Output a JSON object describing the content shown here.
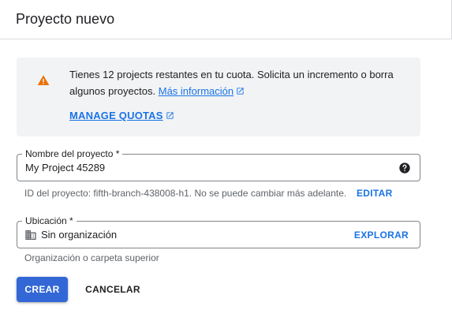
{
  "header": {
    "title": "Proyecto nuevo"
  },
  "notice": {
    "icon": "warning-icon",
    "text": "Tienes 12 projects restantes en tu cuota. Solicita un incremento o borra algunos proyectos.",
    "more_info_link": "Más información",
    "manage_quotas_link": "MANAGE QUOTAS"
  },
  "project_name_field": {
    "label": "Nombre del proyecto *",
    "value": "My Project 45289",
    "help_icon": "help-icon"
  },
  "project_id": {
    "text": "ID del proyecto: fifth-branch-438008-h1. No se puede cambiar más adelante.",
    "edit_label": "EDITAR"
  },
  "location_field": {
    "label": "Ubicación *",
    "icon": "organization-icon",
    "value": "Sin organización",
    "browse_label": "EXPLORAR",
    "hint": "Organización o carpeta superior"
  },
  "actions": {
    "create_label": "CREAR",
    "cancel_label": "CANCELAR"
  },
  "colors": {
    "accent": "#1a73e8",
    "primary_button": "#3367d6",
    "warning": "#e8710a",
    "notice_background": "#f1f3f4"
  }
}
